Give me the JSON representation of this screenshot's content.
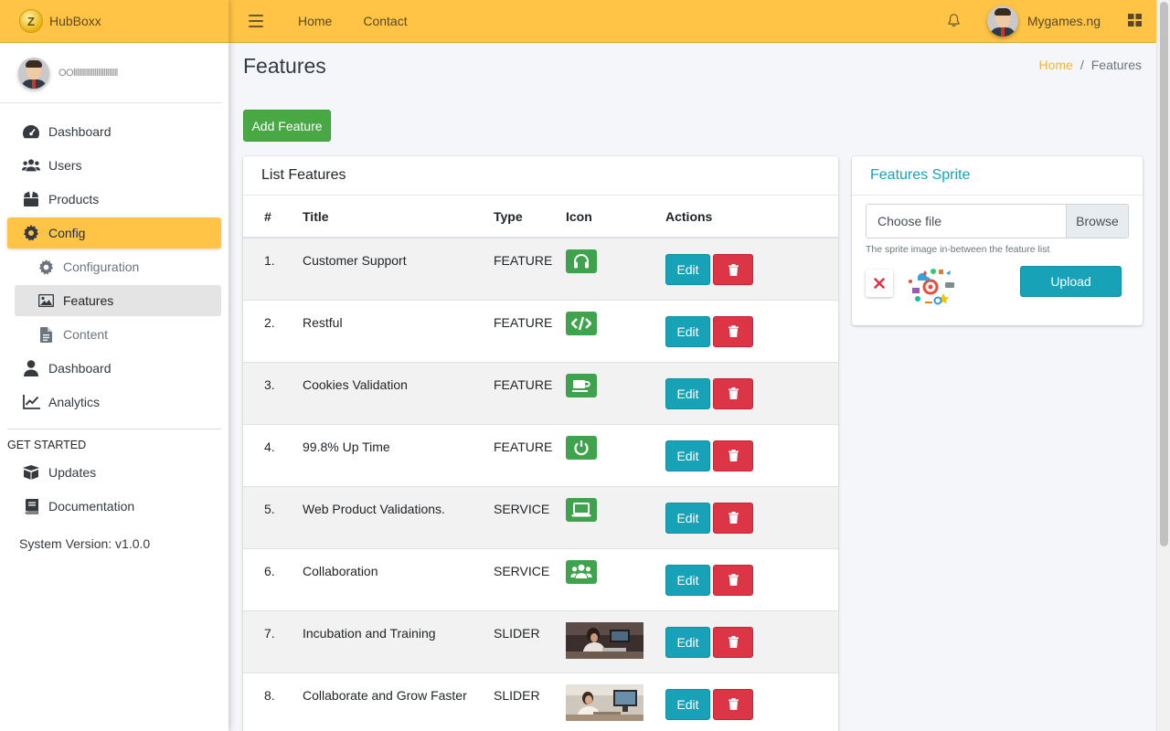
{
  "brand": {
    "name": "HubBoxx",
    "logo_letter": "Z"
  },
  "user": {
    "name": "OOlllllllllllllllllllllllll"
  },
  "sidebar": {
    "items": [
      {
        "label": "Dashboard",
        "icon": "tachometer-icon"
      },
      {
        "label": "Users",
        "icon": "users-icon"
      },
      {
        "label": "Products",
        "icon": "box-icon"
      },
      {
        "label": "Config",
        "icon": "gear-icon",
        "active": true
      },
      {
        "label": "Configuration",
        "icon": "gear-icon",
        "sub": true
      },
      {
        "label": "Features",
        "icon": "image-icon",
        "sub": true,
        "current": true
      },
      {
        "label": "Content",
        "icon": "file-icon",
        "sub": true
      },
      {
        "label": "Dashboard",
        "icon": "user-icon"
      },
      {
        "label": "Analytics",
        "icon": "chart-line-icon"
      }
    ],
    "section_header": "GET STARTED",
    "extra_items": [
      {
        "label": "Updates",
        "icon": "box-open-icon"
      },
      {
        "label": "Documentation",
        "icon": "book-icon"
      }
    ],
    "system_version": "System Version: v1.0.0"
  },
  "topbar": {
    "links": [
      "Home",
      "Contact"
    ],
    "account_name": "Mygames.ng"
  },
  "page": {
    "title": "Features",
    "breadcrumb": {
      "home": "Home",
      "current": "Features"
    },
    "add_button": "Add Feature"
  },
  "list": {
    "title": "List Features",
    "columns": [
      "#",
      "Title",
      "Type",
      "Icon",
      "Actions"
    ],
    "edit_label": "Edit",
    "rows": [
      {
        "num": "1.",
        "title": "Customer Support",
        "type": "FEATURE",
        "icon": "headset-icon"
      },
      {
        "num": "2.",
        "title": "Restful",
        "type": "FEATURE",
        "icon": "code-icon"
      },
      {
        "num": "3.",
        "title": "Cookies Validation",
        "type": "FEATURE",
        "icon": "coffee-icon"
      },
      {
        "num": "4.",
        "title": "99.8% Up Time",
        "type": "FEATURE",
        "icon": "power-icon"
      },
      {
        "num": "5.",
        "title": "Web Product Validations.",
        "type": "SERVICE",
        "icon": "laptop-icon"
      },
      {
        "num": "6.",
        "title": "Collaboration",
        "type": "SERVICE",
        "icon": "users-icon"
      },
      {
        "num": "7.",
        "title": "Incubation and Training",
        "type": "SLIDER",
        "icon": "slider-image-incubation"
      },
      {
        "num": "8.",
        "title": "Collaborate and Grow Faster",
        "type": "SLIDER",
        "icon": "slider-image-collaborate"
      }
    ]
  },
  "sprite": {
    "title": "Features Sprite",
    "file_label": "Choose file",
    "browse_label": "Browse",
    "help": "The sprite image in-between the feature list",
    "upload_label": "Upload"
  },
  "colors": {
    "primary": "#ffc445",
    "success": "#48a944",
    "info": "#17a2b8",
    "danger": "#dc3545",
    "icon_green": "#3fa34d",
    "breadcrumb_link": "#f0b43a"
  }
}
